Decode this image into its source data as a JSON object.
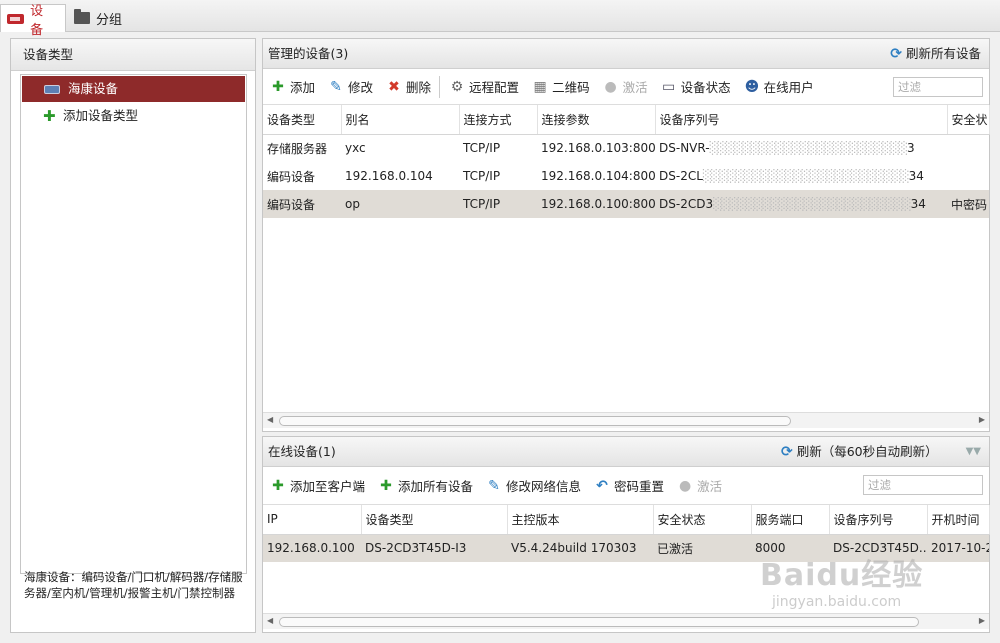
{
  "tabs": [
    {
      "label": "设备"
    },
    {
      "label": "分组"
    }
  ],
  "left": {
    "header": "设备类型",
    "tree": [
      {
        "label": "海康设备"
      },
      {
        "label": "添加设备类型"
      }
    ],
    "note": "海康设备：编码设备/门口机/解码器/存储服务器/室内机/管理机/报警主机/门禁控制器"
  },
  "managed": {
    "title": "管理的设备(3)",
    "refresh_all": "刷新所有设备",
    "toolbar": {
      "add": "添加",
      "edit": "修改",
      "delete": "删除",
      "remote_config": "远程配置",
      "qrcode": "二维码",
      "activate": "激活",
      "device_status": "设备状态",
      "online_users": "在线用户",
      "filter_placeholder": "过滤"
    },
    "columns": [
      "设备类型",
      "别名",
      "连接方式",
      "连接参数",
      "设备序列号",
      "安全状"
    ],
    "rows": [
      {
        "type": "存储服务器",
        "alias": "yxc",
        "conn": "TCP/IP",
        "param": "192.168.0.103:8000",
        "serial": "DS-NVR-",
        "serial_tail": "3",
        "security": ""
      },
      {
        "type": "编码设备",
        "alias": "192.168.0.104",
        "conn": "TCP/IP",
        "param": "192.168.0.104:8000",
        "serial": "DS-2CL",
        "serial_tail": "34",
        "security": ""
      },
      {
        "type": "编码设备",
        "alias": "op",
        "conn": "TCP/IP",
        "param": "192.168.0.100:8000",
        "serial": "DS-2CD3",
        "serial_tail": "34",
        "security": "中密码"
      }
    ]
  },
  "online": {
    "title": "在线设备(1)",
    "refresh": "刷新（每60秒自动刷新）",
    "toolbar": {
      "add_to_client": "添加至客户端",
      "add_all": "添加所有设备",
      "edit_network": "修改网络信息",
      "reset_password": "密码重置",
      "activate": "激活",
      "filter_placeholder": "过滤"
    },
    "columns": [
      "IP",
      "设备类型",
      "主控版本",
      "安全状态",
      "服务端口",
      "设备序列号",
      "开机时间"
    ],
    "rows": [
      {
        "ip": "192.168.0.100",
        "type": "DS-2CD3T45D-I3",
        "version": "V5.4.24build 170303",
        "security": "已激活",
        "port": "8000",
        "serial": "DS-2CD3T45D...",
        "boot": "2017-10-2"
      }
    ]
  },
  "watermark": {
    "brand": "Baidu经验",
    "url": "jingyan.baidu.com"
  }
}
